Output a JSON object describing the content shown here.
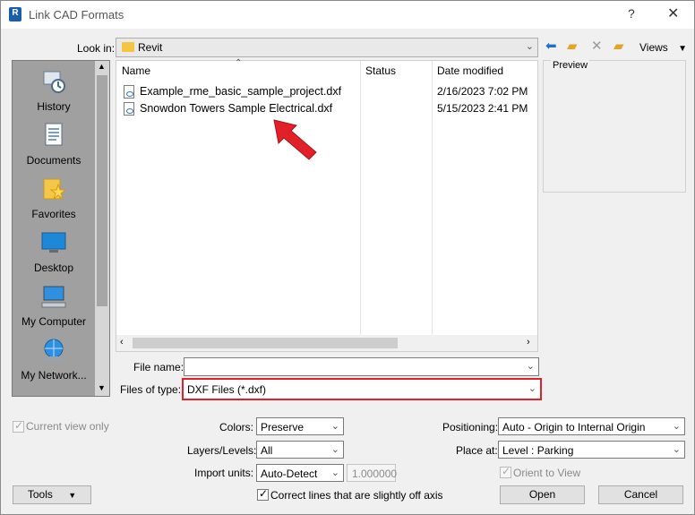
{
  "window": {
    "title": "Link CAD Formats",
    "help_label": "?",
    "close_label": "✕",
    "app_icon_label": "R"
  },
  "lookin": {
    "label": "Look in:",
    "value": "Revit"
  },
  "toolbar": {
    "views_label": "Views"
  },
  "places": [
    {
      "label": "History"
    },
    {
      "label": "Documents"
    },
    {
      "label": "Favorites"
    },
    {
      "label": "Desktop"
    },
    {
      "label": "My Computer"
    },
    {
      "label": "My Network..."
    }
  ],
  "columns": {
    "name": "Name",
    "status": "Status",
    "date": "Date modified"
  },
  "files": [
    {
      "name": "Example_rme_basic_sample_project.dxf",
      "status": "",
      "date": "2/16/2023 7:02 PM"
    },
    {
      "name": "Snowdon Towers Sample Electrical.dxf",
      "status": "",
      "date": "5/15/2023 2:41 PM"
    }
  ],
  "preview": {
    "label": "Preview"
  },
  "filename": {
    "label": "File name:",
    "value": ""
  },
  "filetype": {
    "label": "Files of type:",
    "value": "DXF Files  (*.dxf)"
  },
  "options": {
    "current_view_label": "Current view only",
    "colors_label": "Colors:",
    "colors_value": "Preserve",
    "layers_label": "Layers/Levels:",
    "layers_value": "All",
    "import_units_label": "Import units:",
    "import_units_value": "Auto-Detect",
    "scale_value": "1.000000",
    "correct_lines_label": "Correct lines that are slightly off axis",
    "positioning_label": "Positioning:",
    "positioning_value": "Auto - Origin to Internal Origin",
    "place_at_label": "Place at:",
    "place_at_value": "Level : Parking",
    "orient_label": "Orient to View"
  },
  "buttons": {
    "tools": "Tools",
    "open": "Open",
    "cancel": "Cancel"
  },
  "colors": {
    "highlight": "#e1202a",
    "arrow": "#e1202a"
  }
}
